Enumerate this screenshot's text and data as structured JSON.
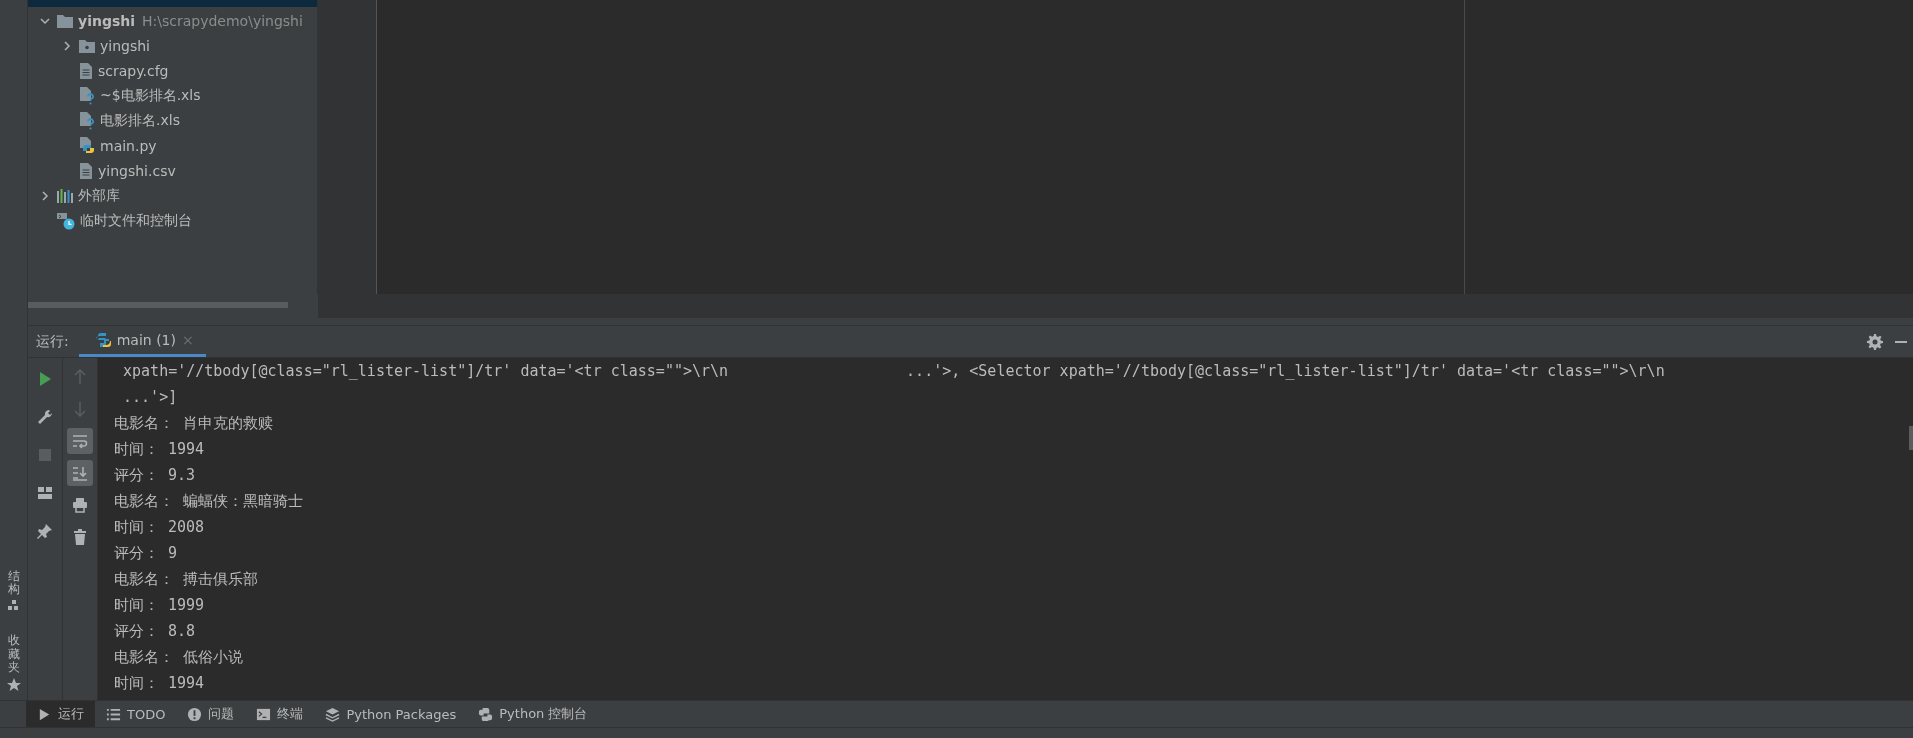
{
  "project": {
    "tree": [
      {
        "label": "yingshi",
        "path": "H:\\scrapydemo\\yingshi",
        "kind": "module",
        "expanded": true,
        "children": [
          {
            "label": "yingshi",
            "kind": "package",
            "expanded": false
          },
          {
            "label": "scrapy.cfg",
            "kind": "text"
          },
          {
            "label": "~$电影排名.xls",
            "kind": "unknown"
          },
          {
            "label": "电影排名.xls",
            "kind": "unknown"
          },
          {
            "label": "main.py",
            "kind": "python"
          },
          {
            "label": "yingshi.csv",
            "kind": "text"
          }
        ]
      },
      {
        "label": "外部库",
        "kind": "library",
        "expanded": false
      },
      {
        "label": "临时文件和控制台",
        "kind": "scratch"
      }
    ]
  },
  "run": {
    "label": "运行:",
    "tabs": [
      {
        "label": "main (1)",
        "close": "×",
        "selected": true
      }
    ],
    "tools": [
      {
        "kind": "rerun",
        "disabled": false
      },
      {
        "kind": "wrench",
        "disabled": false
      },
      {
        "kind": "stop",
        "disabled": true
      },
      {
        "kind": "layout",
        "disabled": false
      },
      {
        "kind": "pin",
        "disabled": false
      }
    ],
    "actions": [
      {
        "kind": "up",
        "disabled": true,
        "on": false
      },
      {
        "kind": "down",
        "disabled": true,
        "on": false
      },
      {
        "kind": "wrap",
        "disabled": false,
        "on": true
      },
      {
        "kind": "scroll-end",
        "disabled": false,
        "on": true
      },
      {
        "kind": "print",
        "disabled": false,
        "on": false
      },
      {
        "kind": "trash",
        "disabled": false,
        "on": false
      }
    ],
    "console": [
      {
        "segments": [
          " xpath='//tbody[@class=\"rl_lister-list\"]/tr' data='<tr class=\"\">\\r\\n",
          "...'>, <Selector xpath='//tbody[@class=\"rl_lister-list\"]/tr' data='<tr class=\"\">\\r\\n"
        ]
      },
      {
        "segments": [
          " ...'>]"
        ]
      },
      {
        "segments": [
          "电影名： 肖申克的救赎"
        ]
      },
      {
        "segments": [
          "时间： 1994"
        ]
      },
      {
        "segments": [
          "评分： 9.3"
        ]
      },
      {
        "segments": [
          "电影名： 蝙蝠侠：黑暗骑士"
        ]
      },
      {
        "segments": [
          "时间： 2008"
        ]
      },
      {
        "segments": [
          "评分： 9"
        ]
      },
      {
        "segments": [
          "电影名： 搏击俱乐部"
        ]
      },
      {
        "segments": [
          "时间： 1999"
        ]
      },
      {
        "segments": [
          "评分： 8.8"
        ]
      },
      {
        "segments": [
          "电影名： 低俗小说"
        ]
      },
      {
        "segments": [
          "时间： 1994"
        ]
      }
    ]
  },
  "side_tabs": [
    {
      "label": "结构",
      "kind": "structure"
    },
    {
      "label": "收藏夹",
      "kind": "favorites"
    }
  ],
  "bottom_tabs": [
    {
      "label": "运行",
      "kind": "run",
      "selected": true
    },
    {
      "label": "TODO",
      "kind": "todo",
      "selected": false
    },
    {
      "label": "问题",
      "kind": "problems",
      "selected": false
    },
    {
      "label": "终端",
      "kind": "terminal",
      "selected": false
    },
    {
      "label": "Python Packages",
      "kind": "packages",
      "selected": false
    },
    {
      "label": "Python 控制台",
      "kind": "console",
      "selected": false
    }
  ]
}
